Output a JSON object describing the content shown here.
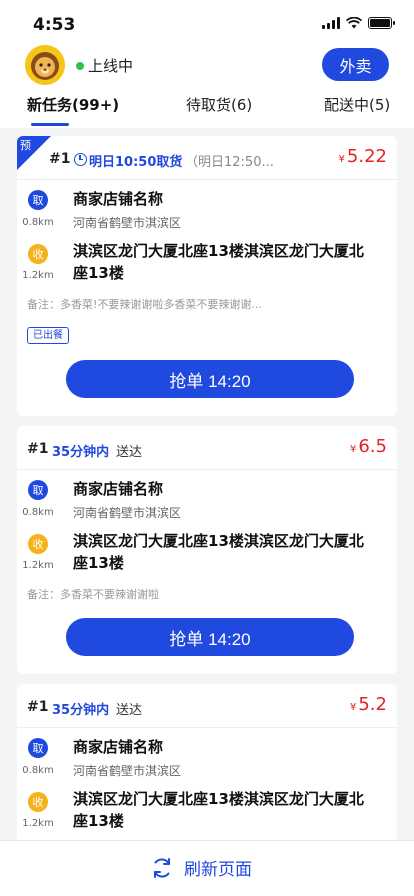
{
  "status_bar": {
    "time": "4:53"
  },
  "header": {
    "status_text": "上线中",
    "takeout_label": "外卖",
    "online_color": "#2ec24a"
  },
  "tabs": [
    {
      "label": "新任务(99+)",
      "active": true
    },
    {
      "label": "待取货(6)",
      "active": false
    },
    {
      "label": "配送中(5)",
      "active": false
    }
  ],
  "cards": [
    {
      "badge": "预",
      "order_no": "#1",
      "pickup_time": "明日10:50取货",
      "sub_time": "（明日12:50...",
      "currency": "¥",
      "price": "5.22",
      "pickup_badge": "取",
      "pickup_dist": "0.8km",
      "shop_name": "商家店铺名称",
      "shop_addr": "河南省鹤壁市淇滨区",
      "recv_badge": "收",
      "recv_dist": "1.2km",
      "dest_addr": "淇滨区龙门大厦北座13楼淇滨区龙门大厦北座13楼",
      "note": "备注：多香菜!不要辣谢谢啦多香菜不要辣谢谢...",
      "tag": "已出餐",
      "grab_label": "抢单 14:20"
    },
    {
      "order_no": "#1",
      "deliver_within": "35分钟内",
      "deliver_word": "送达",
      "currency": "¥",
      "price": "6.5",
      "pickup_badge": "取",
      "pickup_dist": "0.8km",
      "shop_name": "商家店铺名称",
      "shop_addr": "河南省鹤壁市淇滨区",
      "recv_badge": "收",
      "recv_dist": "1.2km",
      "dest_addr": "淇滨区龙门大厦北座13楼淇滨区龙门大厦北座13楼",
      "note": "备注：多香菜不要辣谢谢啦",
      "grab_label": "抢单 14:20"
    },
    {
      "order_no": "#1",
      "deliver_within": "35分钟内",
      "deliver_word": "送达",
      "currency": "¥",
      "price": "5.2",
      "pickup_badge": "取",
      "pickup_dist": "0.8km",
      "shop_name": "商家店铺名称",
      "shop_addr": "河南省鹤壁市淇滨区",
      "recv_badge": "收",
      "recv_dist": "1.2km",
      "dest_addr": "淇滨区龙门大厦北座13楼淇滨区龙门大厦北座13楼"
    }
  ],
  "bottom": {
    "refresh_label": "刷新页面",
    "icon": "refresh-icon"
  },
  "colors": {
    "accent": "#2049e0",
    "price": "#e32424",
    "receive": "#f5b21b"
  }
}
